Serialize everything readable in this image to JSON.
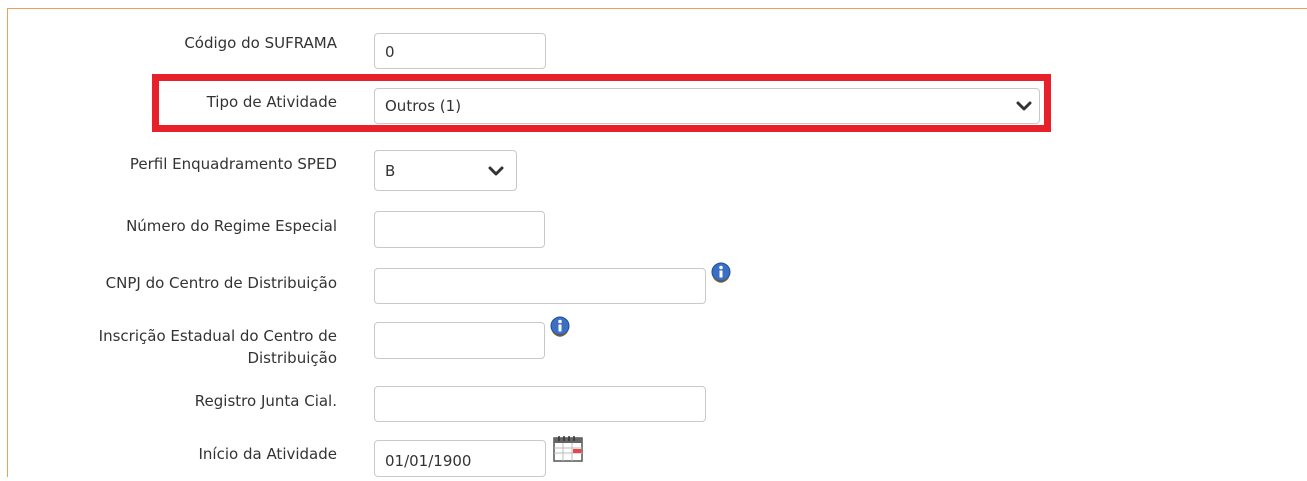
{
  "form": {
    "suframa": {
      "label": "Código do SUFRAMA",
      "value": "0"
    },
    "tipo_atividade": {
      "label": "Tipo de Atividade",
      "value": "Outros (1)"
    },
    "perfil_sped": {
      "label": "Perfil Enquadramento SPED",
      "value": "B"
    },
    "regime_especial": {
      "label": "Número do Regime Especial",
      "value": ""
    },
    "cnpj_centro": {
      "label": "CNPJ do Centro de Distribuição",
      "value": ""
    },
    "ie_centro": {
      "label_line1": "Inscrição Estadual do Centro de",
      "label_line2": "Distribuição",
      "value": ""
    },
    "registro_junta": {
      "label": "Registro Junta Cial.",
      "value": ""
    },
    "inicio_atividade": {
      "label": "Início da Atividade",
      "value": "01/01/1900"
    }
  },
  "icons": {
    "chevron": "chevron-down-icon",
    "info": "info-icon",
    "calendar": "calendar-icon"
  },
  "colors": {
    "panel_border": "#f0a050",
    "highlight": "#e8202a",
    "field_border": "#c9c9c9",
    "info_blue": "#3a6fc4"
  }
}
